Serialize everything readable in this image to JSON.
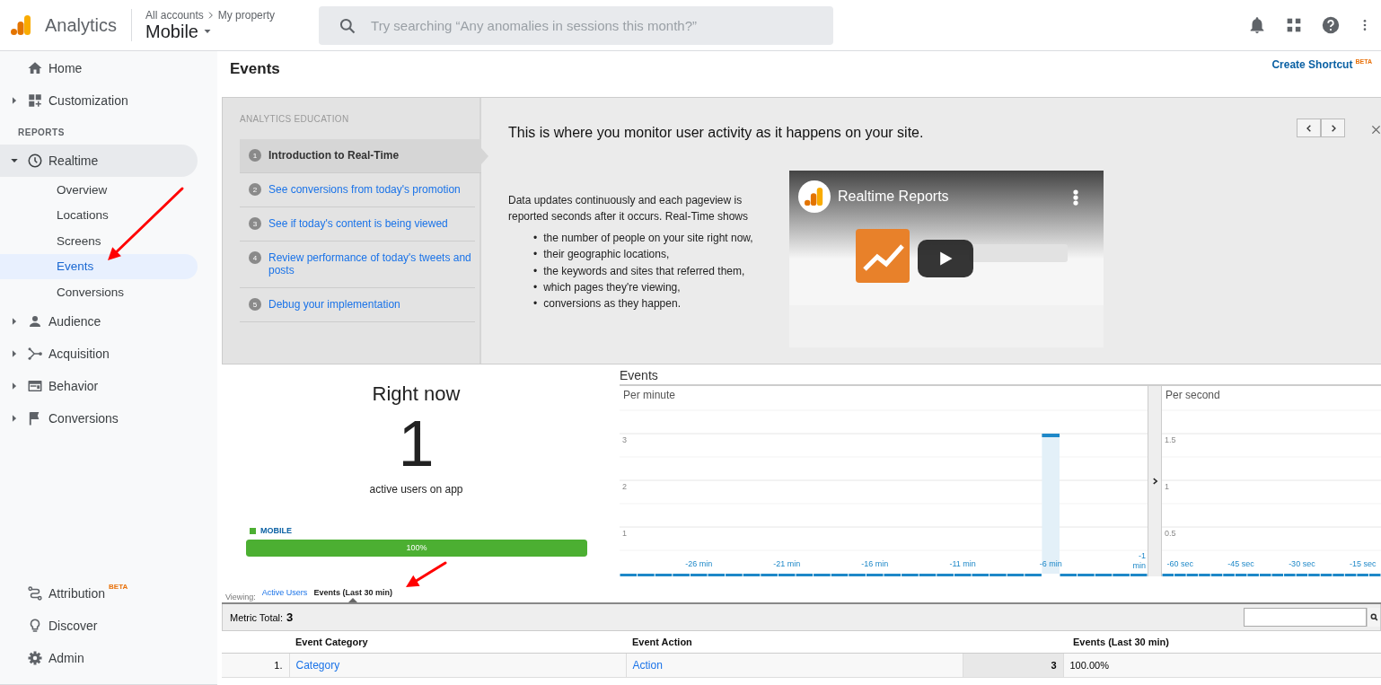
{
  "app": {
    "name": "Analytics",
    "breadcrumb": [
      "All accounts",
      "My property"
    ],
    "property": "Mobile"
  },
  "search": {
    "placeholder": "Try searching “Any anomalies in sessions this month?”"
  },
  "sidebar": {
    "top": [
      {
        "label": "Home"
      },
      {
        "label": "Customization",
        "expanded": false
      }
    ],
    "section_label": "REPORTS",
    "reports": [
      {
        "label": "Realtime",
        "expanded": true,
        "selected": true,
        "children": [
          {
            "label": "Overview",
            "selected": false
          },
          {
            "label": "Locations",
            "selected": false
          },
          {
            "label": "Screens",
            "selected": false
          },
          {
            "label": "Events",
            "selected": true
          },
          {
            "label": "Conversions",
            "selected": false
          }
        ]
      },
      {
        "label": "Audience",
        "expanded": false,
        "selected": false
      },
      {
        "label": "Acquisition",
        "expanded": false,
        "selected": false
      },
      {
        "label": "Behavior",
        "expanded": false,
        "selected": false
      },
      {
        "label": "Conversions",
        "expanded": false,
        "selected": false
      }
    ],
    "bottom": [
      {
        "label": "Attribution",
        "badge": "BETA"
      },
      {
        "label": "Discover"
      },
      {
        "label": "Admin"
      }
    ]
  },
  "page": {
    "title": "Events",
    "shortcut": "Create Shortcut",
    "shortcut_badge": "BETA"
  },
  "education": {
    "heading": "ANALYTICS EDUCATION",
    "steps": [
      {
        "number": "1",
        "label": "Introduction to Real-Time",
        "selected": true
      },
      {
        "number": "2",
        "label": "See conversions from today's promotion",
        "selected": false
      },
      {
        "number": "3",
        "label": "See if today's content is being viewed",
        "selected": false
      },
      {
        "number": "4",
        "label": "Review performance of today's tweets and posts",
        "selected": false
      },
      {
        "number": "5",
        "label": "Debug your implementation",
        "selected": false
      }
    ],
    "title": "This is where you monitor user activity as it happens on your site.",
    "body": "Data updates continuously and each pageview is reported seconds after it occurs. Real-Time shows",
    "bullets": [
      {
        "marker": "•",
        "text": "the number of people on your site right now,"
      },
      {
        "marker": "•",
        "text": "their geographic locations,"
      },
      {
        "marker": "•",
        "text": "the keywords and sites that referred them,"
      },
      {
        "marker": "•",
        "text": "which pages they're viewing,"
      },
      {
        "marker": "•",
        "text": "conversions as they happen."
      }
    ],
    "video": {
      "title": "Realtime Reports"
    }
  },
  "realtime": {
    "heading": "Right now",
    "count": "1",
    "caption": "active users on app",
    "segments": [
      {
        "label": "MOBILE",
        "color": "#4caf32",
        "level": 1,
        "reading": "100%"
      }
    ]
  },
  "events": {
    "title": "Events",
    "per_minute": {
      "chart_data": {
        "type": "bar",
        "title": "Per minute",
        "x": [
          -30,
          -29,
          -28,
          -27,
          -26,
          -25,
          -24,
          -23,
          -22,
          -21,
          -20,
          -19,
          -18,
          -17,
          -16,
          -15,
          -14,
          -13,
          -12,
          -11,
          -10,
          -9,
          -8,
          -7,
          -6,
          -5,
          -4,
          -3,
          -2,
          -1
        ],
        "values": [
          0,
          0,
          0,
          0,
          0,
          0,
          0,
          0,
          0,
          0,
          0,
          0,
          0,
          0,
          0,
          0,
          0,
          0,
          0,
          0,
          0,
          0,
          0,
          0,
          3,
          0,
          0,
          0,
          0,
          0
        ],
        "xlim": [
          -30.5,
          -0.5
        ],
        "ylim": [
          0,
          3.5
        ],
        "yticks": [
          1,
          2,
          3
        ],
        "grid": true,
        "xticks": [
          {
            "value": -26,
            "label": "-26 min"
          },
          {
            "value": -21,
            "label": "-21 min"
          },
          {
            "value": -16,
            "label": "-16 min"
          },
          {
            "value": -11,
            "label": "-11 min"
          },
          {
            "value": -6,
            "label": "-6 min"
          },
          {
            "value": -1,
            "label": "-1 min"
          }
        ]
      }
    },
    "per_second": {
      "chart_data": {
        "type": "bar",
        "title": "Per second",
        "x": [
          -63,
          -60,
          -57,
          -54,
          -51,
          -48,
          -45,
          -42,
          -39,
          -36,
          -33,
          -30,
          -27,
          -24,
          -21,
          -18,
          -15,
          -12
        ],
        "values": [
          0,
          0,
          0,
          0,
          0,
          0,
          0,
          0,
          0,
          0,
          0,
          0,
          0,
          0,
          0,
          0,
          0,
          0
        ],
        "xlim": [
          -64.5,
          -10.5
        ],
        "ylim": [
          0,
          1.75
        ],
        "yticks": [
          0.5,
          1,
          1.5
        ],
        "grid": true,
        "xticks": [
          {
            "value": -60,
            "label": "-60 sec"
          },
          {
            "value": -45,
            "label": "-45 sec"
          },
          {
            "value": -30,
            "label": "-30 sec"
          },
          {
            "value": -15,
            "label": "-15 sec"
          }
        ]
      }
    }
  },
  "viewing": {
    "label": "Viewing:",
    "options": [
      {
        "label": "Active Users",
        "selected": false
      },
      {
        "label": "Events (Last 30 min)",
        "selected": true
      }
    ]
  },
  "table": {
    "metric_label": "Metric Total:",
    "metric_value": "3",
    "columns": [
      "Event Category",
      "Event Action",
      "Events (Last 30 min)"
    ],
    "rows": [
      {
        "index": "1.",
        "category": "Category",
        "action": "Action",
        "value": "3",
        "percent": "100.00%"
      }
    ]
  },
  "annotations": [
    {
      "kind": "arrow"
    },
    {
      "kind": "arrow"
    }
  ]
}
